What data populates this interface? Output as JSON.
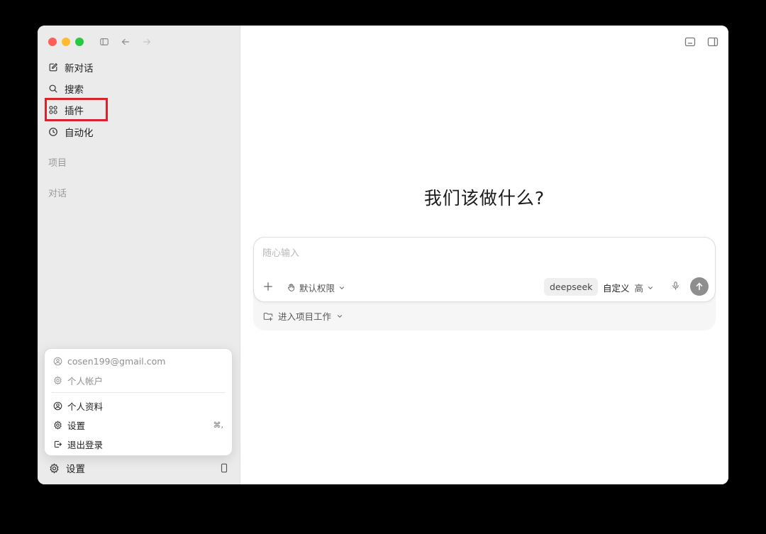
{
  "sidebar": {
    "nav": [
      {
        "label": "新对话",
        "icon": "edit-icon"
      },
      {
        "label": "搜索",
        "icon": "search-icon"
      },
      {
        "label": "插件",
        "icon": "plugins-icon"
      },
      {
        "label": "自动化",
        "icon": "clock-icon"
      }
    ],
    "sections": {
      "projects": "项目",
      "conversations": "对话"
    },
    "footer": {
      "settings_label": "设置"
    }
  },
  "account_menu": {
    "email": "cosen199@gmail.com",
    "account": "个人帐户",
    "profile": "个人资料",
    "settings": "设置",
    "settings_shortcut": "⌘,",
    "logout": "退出登录"
  },
  "main": {
    "title": "我们该做什么?",
    "composer": {
      "placeholder": "随心输入",
      "permission_label": "默认权限",
      "model": "deepseek",
      "mode_label": "自定义",
      "mode_level": "高"
    },
    "project_button": "进入项目工作"
  },
  "colors": {
    "highlight": "#d9232c",
    "sidebar_bg": "#ebebeb",
    "send_button": "#8e8e8e"
  }
}
